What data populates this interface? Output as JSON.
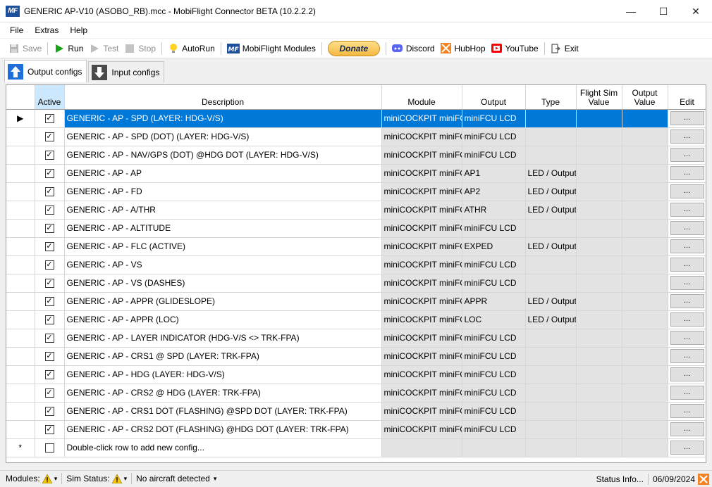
{
  "window": {
    "title": "GENERIC AP-V10 (ASOBO_RB).mcc - MobiFlight Connector BETA (10.2.2.2)",
    "logo_text": "MF",
    "minimize": "—",
    "maximize": "☐",
    "close": "✕"
  },
  "menu": [
    "File",
    "Extras",
    "Help"
  ],
  "toolbar": {
    "save": "Save",
    "run": "Run",
    "test": "Test",
    "stop": "Stop",
    "autorun": "AutoRun",
    "modules": "MobiFlight Modules",
    "donate": "Donate",
    "discord": "Discord",
    "hubhop": "HubHop",
    "youtube": "YouTube",
    "exit": "Exit",
    "colors": {
      "run": "#1aa31a",
      "discord": "#5865f2",
      "youtube": "#ff0000",
      "hubhop": "#f58220"
    }
  },
  "tabs": [
    {
      "label": "Output configs",
      "active": true
    },
    {
      "label": "Input configs",
      "active": false
    }
  ],
  "grid": {
    "columns": {
      "active": "Active",
      "description": "Description",
      "module": "Module",
      "output": "Output",
      "type": "Type",
      "flight_sim_value_1": "Flight Sim",
      "flight_sim_value_2": "Value",
      "output_value_1": "Output",
      "output_value_2": "Value",
      "edit": "Edit"
    },
    "edit_label": "...",
    "rows": [
      {
        "description": "GENERIC - AP - SPD (LAYER: HDG-V/S)",
        "module": "miniCOCKPIT miniFCU",
        "output": "miniFCU LCD",
        "type": ""
      },
      {
        "description": "GENERIC - AP - SPD (DOT) (LAYER: HDG-V/S)",
        "module": "miniCOCKPIT miniFCU",
        "output": "miniFCU LCD",
        "type": ""
      },
      {
        "description": "GENERIC - AP - NAV/GPS (DOT) @HDG DOT (LAYER: HDG-V/S)",
        "module": "miniCOCKPIT miniFCU",
        "output": "miniFCU LCD",
        "type": ""
      },
      {
        "description": "GENERIC - AP - AP",
        "module": "miniCOCKPIT miniFCU",
        "output": "AP1",
        "type": "LED / Output"
      },
      {
        "description": "GENERIC - AP - FD",
        "module": "miniCOCKPIT miniFCU",
        "output": "AP2",
        "type": "LED / Output"
      },
      {
        "description": "GENERIC - AP - A/THR",
        "module": "miniCOCKPIT miniFCU",
        "output": "ATHR",
        "type": "LED / Output"
      },
      {
        "description": "GENERIC - AP - ALTITUDE",
        "module": "miniCOCKPIT miniFCU",
        "output": "miniFCU LCD",
        "type": ""
      },
      {
        "description": "GENERIC - AP - FLC (ACTIVE)",
        "module": "miniCOCKPIT miniFCU",
        "output": "EXPED",
        "type": "LED / Output"
      },
      {
        "description": "GENERIC - AP - VS",
        "module": "miniCOCKPIT miniFCU",
        "output": "miniFCU LCD",
        "type": ""
      },
      {
        "description": "GENERIC - AP - VS (DASHES)",
        "module": "miniCOCKPIT miniFCU",
        "output": "miniFCU LCD",
        "type": ""
      },
      {
        "description": "GENERIC - AP - APPR (GLIDESLOPE)",
        "module": "miniCOCKPIT miniFCU",
        "output": "APPR",
        "type": "LED / Output"
      },
      {
        "description": "GENERIC - AP - APPR (LOC)",
        "module": "miniCOCKPIT miniFCU",
        "output": "LOC",
        "type": "LED / Output"
      },
      {
        "description": "GENERIC - AP - LAYER INDICATOR (HDG-V/S <> TRK-FPA)",
        "module": "miniCOCKPIT miniFCU",
        "output": "miniFCU LCD",
        "type": ""
      },
      {
        "description": "GENERIC - AP - CRS1 @ SPD (LAYER: TRK-FPA)",
        "module": "miniCOCKPIT miniFCU",
        "output": "miniFCU LCD",
        "type": ""
      },
      {
        "description": "GENERIC - AP - HDG (LAYER: HDG-V/S)",
        "module": "miniCOCKPIT miniFCU",
        "output": "miniFCU LCD",
        "type": ""
      },
      {
        "description": "GENERIC - AP - CRS2 @ HDG (LAYER: TRK-FPA)",
        "module": "miniCOCKPIT miniFCU",
        "output": "miniFCU LCD",
        "type": ""
      },
      {
        "description": "GENERIC - AP - CRS1 DOT (FLASHING) @SPD DOT (LAYER: TRK-FPA)",
        "module": "miniCOCKPIT miniFCU",
        "output": "miniFCU LCD",
        "type": ""
      },
      {
        "description": "GENERIC - AP - CRS2 DOT (FLASHING) @HDG DOT (LAYER: TRK-FPA)",
        "module": "miniCOCKPIT miniFCU",
        "output": "miniFCU LCD",
        "type": ""
      }
    ],
    "new_row_text": "Double-click row to add new config...",
    "selected_row": 0,
    "current_row_marker": "▶",
    "new_row_marker": "*",
    "check_mark": "✓",
    "selection_color": "#0078d7"
  },
  "statusbar": {
    "modules_label": "Modules:",
    "sim_status_label": "Sim Status:",
    "aircraft": "No aircraft detected",
    "status_info": "Status Info...",
    "date": "06/09/2024",
    "dropdown_glyph": "▾"
  }
}
